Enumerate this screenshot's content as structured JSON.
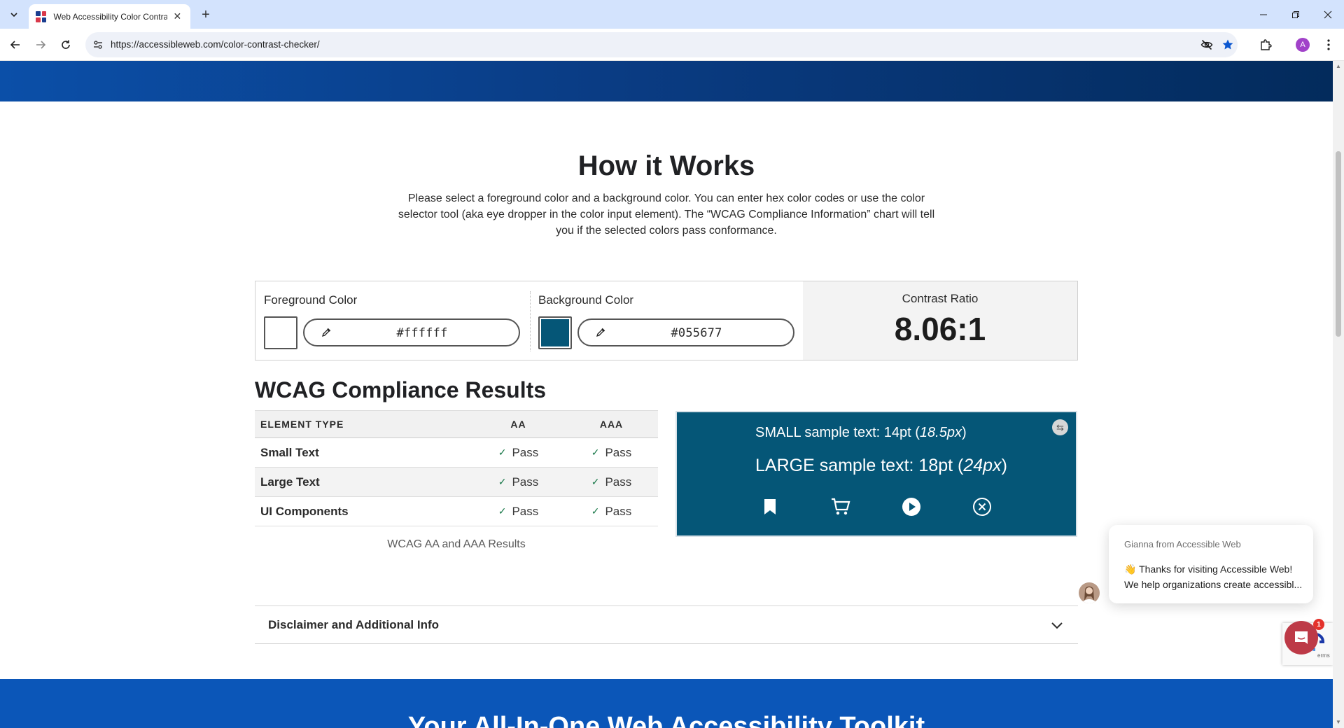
{
  "browser": {
    "tab_title": "Web Accessibility Color Contrast Checker",
    "url": "https://accessibleweb.com/color-contrast-checker/",
    "profile_initial": "A"
  },
  "how_it_works": {
    "title": "How it Works",
    "description": "Please select a foreground color and a background color. You can enter hex color codes or use the color selector tool (aka eye dropper in the color input element). The “WCAG Compliance Information” chart will tell you if the selected colors pass conformance."
  },
  "checker": {
    "foreground_label": "Foreground Color",
    "foreground_value": "#ffffff",
    "foreground_color": "#ffffff",
    "background_label": "Background Color",
    "background_value": "#055677",
    "background_color": "#055677",
    "ratio_label": "Contrast Ratio",
    "ratio_value": "8.06:1"
  },
  "results": {
    "title": "WCAG Compliance Results",
    "headers": [
      "ELEMENT TYPE",
      "AA",
      "AAA"
    ],
    "rows": [
      {
        "type": "Small Text",
        "aa": "Pass",
        "aaa": "Pass"
      },
      {
        "type": "Large Text",
        "aa": "Pass",
        "aaa": "Pass"
      },
      {
        "type": "UI Components",
        "aa": "Pass",
        "aaa": "Pass"
      }
    ],
    "caption": "WCAG AA and AAA Results"
  },
  "preview": {
    "small_prefix": "SMALL sample text: 14pt (",
    "small_em": "18.5px",
    "small_suffix": ")",
    "large_prefix": "LARGE sample text: 18pt (",
    "large_em": "24px",
    "large_suffix": ")",
    "icons": [
      "bookmark-icon",
      "cart-icon",
      "play-icon",
      "close-circle-icon"
    ]
  },
  "disclaimer": {
    "title": "Disclaimer and Additional Info"
  },
  "banner": {
    "title": "Your All-In-One Web Accessibility Toolkit"
  },
  "chat": {
    "from": "Gianna from Accessible Web",
    "message": "👋 Thanks for visiting Accessible Web! We help organizations create accessibl...",
    "badge_count": "1"
  },
  "recaptcha": {
    "text": "erms"
  }
}
